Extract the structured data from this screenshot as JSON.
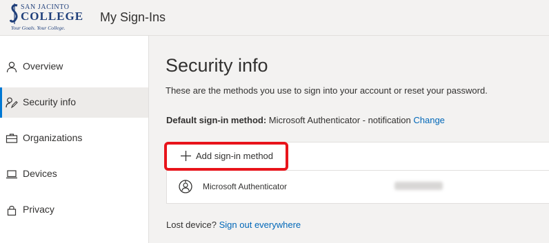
{
  "header": {
    "logo": {
      "line1": "SAN JACINTO",
      "line2": "COLLEGE",
      "line3": "Your Goals. Your College."
    },
    "app_title": "My Sign-Ins"
  },
  "sidebar": {
    "items": [
      {
        "label": "Overview",
        "icon": "person-icon",
        "active": false
      },
      {
        "label": "Security info",
        "icon": "security-info-icon",
        "active": true
      },
      {
        "label": "Organizations",
        "icon": "briefcase-icon",
        "active": false
      },
      {
        "label": "Devices",
        "icon": "laptop-icon",
        "active": false
      },
      {
        "label": "Privacy",
        "icon": "lock-icon",
        "active": false
      }
    ]
  },
  "main": {
    "title": "Security info",
    "subtitle": "These are the methods you use to sign into your account or reset your password.",
    "default_method": {
      "label": "Default sign-in method:",
      "value": "Microsoft Authenticator - notification",
      "change_link": "Change"
    },
    "add_method_label": "Add sign-in method",
    "methods": [
      {
        "name": "Microsoft Authenticator",
        "icon": "authenticator-icon",
        "detail_redacted": true
      }
    ],
    "lost_device": {
      "label": "Lost device?",
      "link": "Sign out everywhere"
    }
  },
  "colors": {
    "accent": "#0078d4",
    "link": "#0067b8",
    "highlight": "#e8141b"
  }
}
